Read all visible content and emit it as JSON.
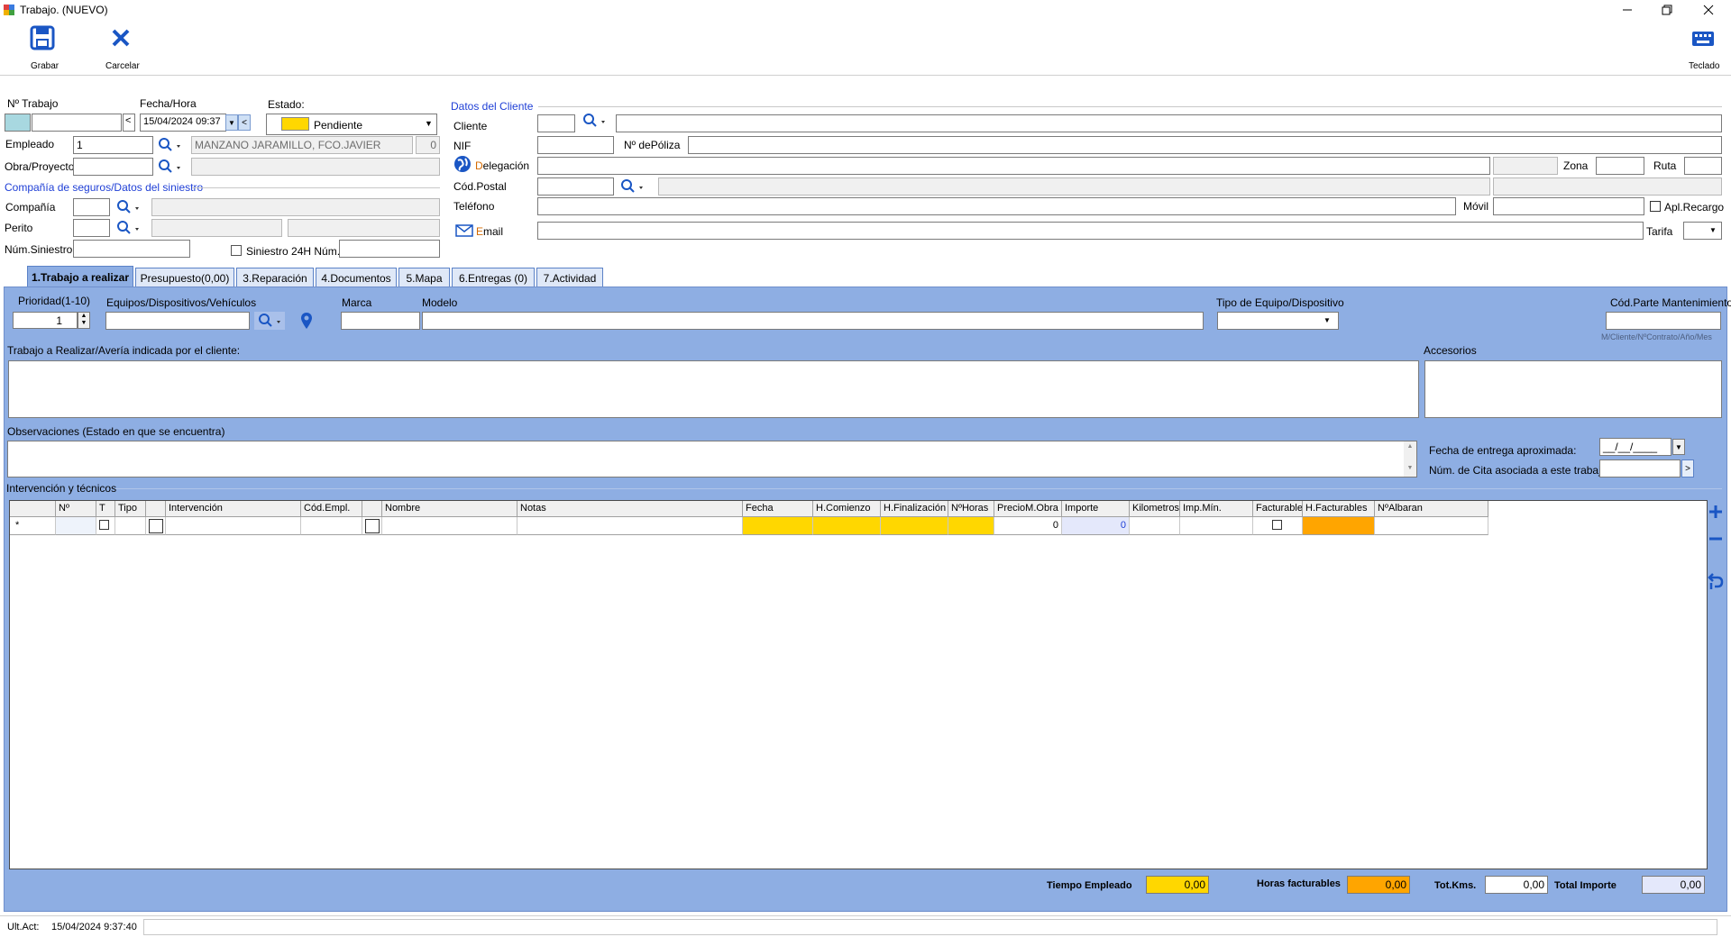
{
  "window": {
    "title": "Trabajo. (NUEVO)"
  },
  "toolbar": {
    "save_label": "Grabar",
    "cancel_label": "Carcelar",
    "keyboard_label": "Teclado"
  },
  "header": {
    "n_trabajo_label": "Nº Trabajo",
    "fecha_hora_label": "Fecha/Hora",
    "fecha_hora_value": "15/04/2024 09:37",
    "estado_label": "Estado:",
    "estado_value": "Pendiente",
    "estado_color": "#ffd700",
    "empleado_label": "Empleado",
    "empleado_value": "1",
    "empleado_name": "MANZANO JARAMILLO, FCO.JAVIER",
    "empleado_num": "0",
    "obra_label": "Obra/Proyecto",
    "seguros_section": "Compañía de seguros/Datos del siniestro",
    "compania_label": "Compañía",
    "perito_label": "Perito",
    "num_siniestro_label": "Núm.Siniestro",
    "siniestro24_label": "Siniestro 24H Núm."
  },
  "cliente": {
    "section": "Datos del Cliente",
    "cliente_label": "Cliente",
    "nif_label": "NIF",
    "poliza_label": "Nº dePóliza",
    "delegacion_label_first": "D",
    "delegacion_label_rest": "elegación",
    "zona_label": "Zona",
    "ruta_label": "Ruta",
    "cod_postal_label": "Cód.Postal",
    "telefono_label": "Teléfono",
    "movil_label": "Móvil",
    "apl_recargo_label": "Apl.Recargo",
    "email_label_first": "E",
    "email_label_rest": "mail",
    "tarifa_label": "Tarifa"
  },
  "tabs": [
    {
      "label": "1.Trabajo a realizar"
    },
    {
      "label": "Presupuesto(0,00)"
    },
    {
      "label": "3.Reparación"
    },
    {
      "label": "4.Documentos"
    },
    {
      "label": "5.Mapa"
    },
    {
      "label": "6.Entregas (0)"
    },
    {
      "label": "7.Actividad"
    }
  ],
  "trabajo": {
    "prioridad_label": "Prioridad(1-10)",
    "prioridad_value": "1",
    "equipos_label": "Equipos/Dispositivos/Vehículos",
    "marca_label": "Marca",
    "modelo_label": "Modelo",
    "tipo_equipo_label": "Tipo de Equipo/Dispositivo",
    "cod_parte_label": "Cód.Parte Mantenimiento",
    "cod_parte_hint": "M/Cliente/NºContrato/Año/Mes",
    "averia_label": "Trabajo a Realizar/Avería indicada por el cliente:",
    "accesorios_label": "Accesorios",
    "observaciones_label": "Observaciones (Estado en que se encuentra)",
    "fecha_entrega_label": "Fecha de entrega aproximada:",
    "fecha_entrega_value": "__/__/____",
    "num_cita_label": "Núm. de Cita asociada a este  trabajo",
    "intervencion_label": "Intervención y técnicos"
  },
  "grid": {
    "columns": [
      "Nº",
      "T",
      "Tipo",
      "Intervención",
      "Cód.Empl.",
      "Nombre",
      "Notas",
      "Fecha",
      "H.Comienzo",
      "H.Finalización",
      "NºHoras",
      "PrecioM.Obra",
      "Importe",
      "Kilometros",
      "Imp.Mín.",
      "Facturable",
      "H.Facturables",
      "NºAlbaran"
    ],
    "new_row_marker": "*",
    "precio_value": "0",
    "importe_value": "0",
    "highlight_yellow": "#ffd700",
    "highlight_orange": "#ffa500"
  },
  "totals": {
    "tiempo_label": "Tiempo Empleado",
    "tiempo_value": "0,00",
    "horas_label": "Horas facturables",
    "horas_value": "0,00",
    "kms_label": "Tot.Kms.",
    "kms_value": "0,00",
    "importe_label": "Total Importe",
    "importe_value": "0,00"
  },
  "status": {
    "label": "Ult.Act:",
    "value": "15/04/2024 9:37:40"
  }
}
